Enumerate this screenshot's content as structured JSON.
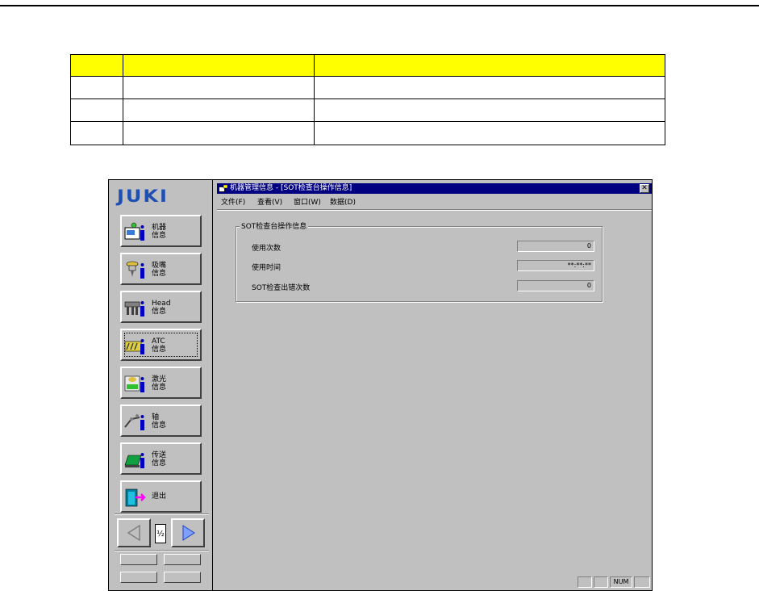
{
  "window": {
    "title": "机器管理信息 - [SOT检查台操作信息]",
    "close_label": "✕"
  },
  "menu": [
    "文件(F)",
    "查看(V)",
    "窗口(W)",
    "数据(D)"
  ],
  "logo": "JUKI",
  "nav_buttons": [
    {
      "label": "机器\n信息",
      "icon": "machine-info-icon"
    },
    {
      "label": "吸嘴\n信息",
      "icon": "nozzle-info-icon"
    },
    {
      "label": "Head\n信息",
      "icon": "head-info-icon"
    },
    {
      "label": "ATC\n信息",
      "icon": "atc-info-icon"
    },
    {
      "label": "激光\n信息",
      "icon": "laser-info-icon"
    },
    {
      "label": "轴\n信息",
      "icon": "axis-info-icon"
    },
    {
      "label": "传送\n信息",
      "icon": "conveyor-info-icon"
    },
    {
      "label": "退出",
      "icon": "exit-door-icon"
    }
  ],
  "pager": {
    "indicator": "½"
  },
  "group": {
    "title": "SOT检查台操作信息",
    "fields": [
      {
        "label": "使用次数",
        "value": "0"
      },
      {
        "label": "使用时间",
        "value": "**:**:**"
      },
      {
        "label": "SOT检查出错次数",
        "value": "0"
      }
    ]
  },
  "status": {
    "num": "NUM"
  },
  "colors": {
    "titlebar": "#000080",
    "logo": "#1e50b4",
    "table_header": "#ffff00",
    "face": "#c0c0c0"
  }
}
